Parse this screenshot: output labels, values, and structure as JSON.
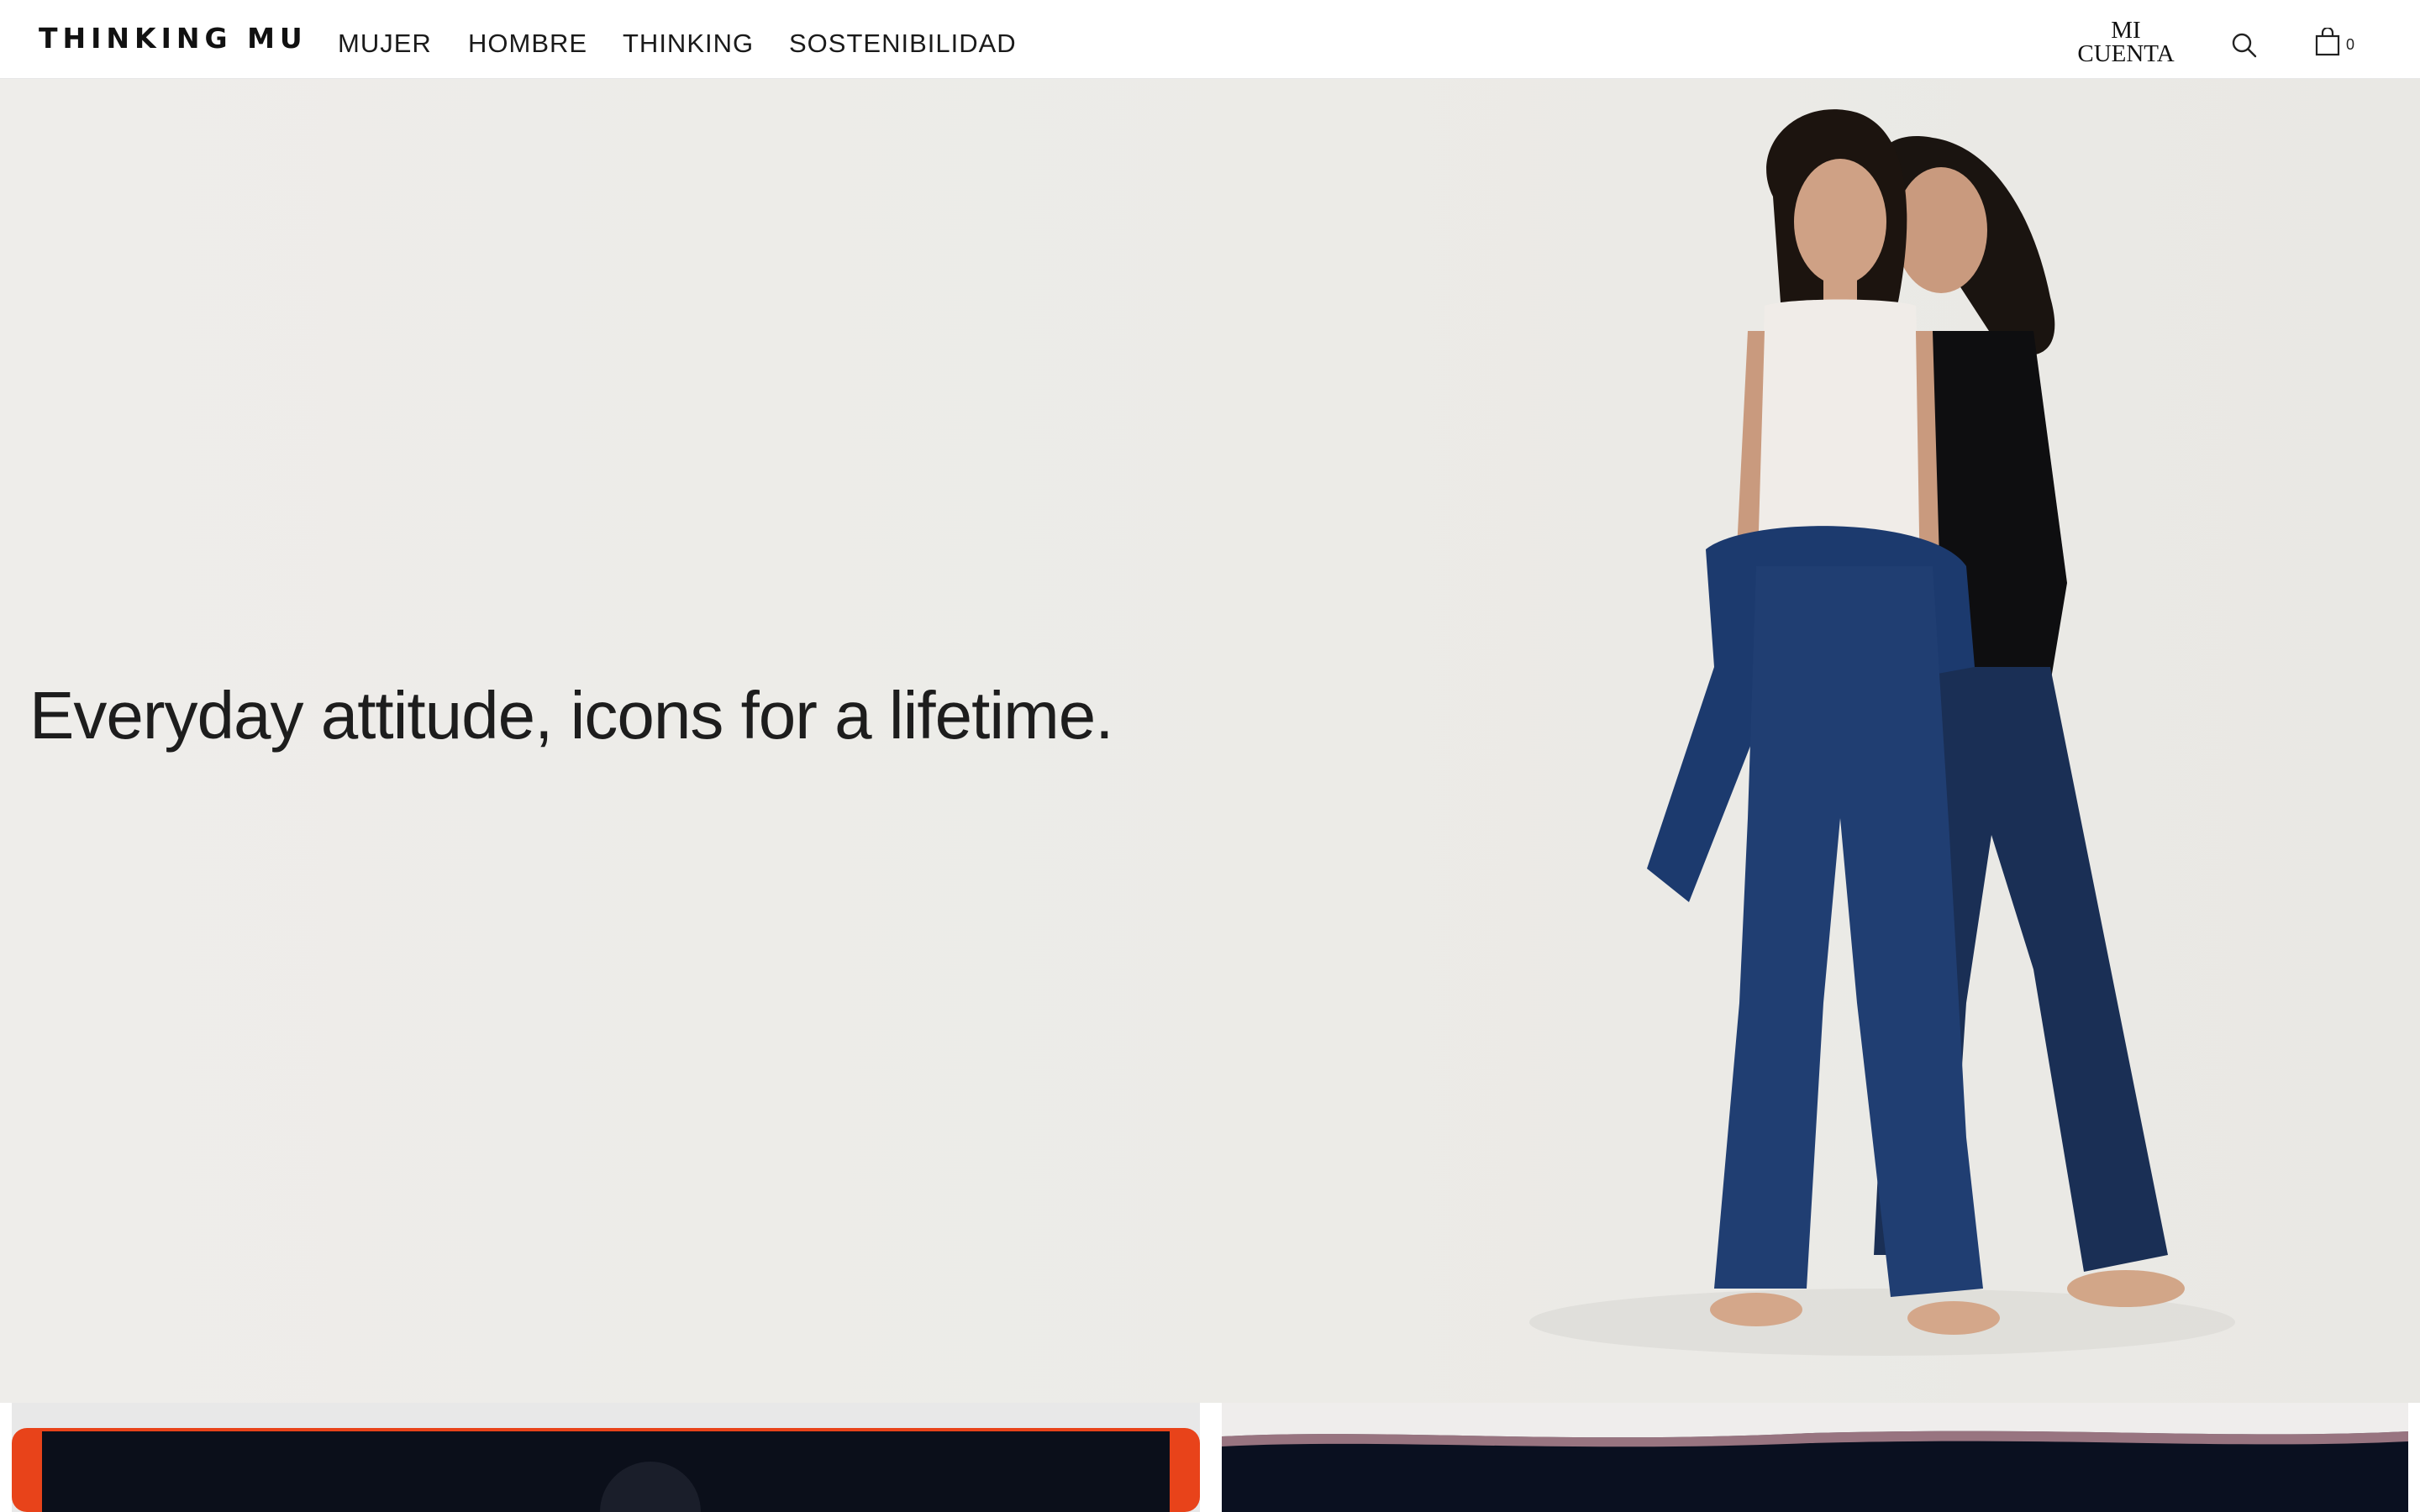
{
  "brand": {
    "logo_text": "THINKING MU"
  },
  "nav": {
    "items": [
      {
        "label": "MUJER"
      },
      {
        "label": "HOMBRE"
      },
      {
        "label": "THINKING"
      },
      {
        "label": "SOSTENIBILIDAD"
      }
    ]
  },
  "header_actions": {
    "account_line1": "MI",
    "account_line2": "CUENTA",
    "search_icon": "search-icon",
    "cart_icon": "shopping-bag-icon",
    "cart_count": "0"
  },
  "hero": {
    "headline": "Everyday attitude, icons for a lifetime."
  },
  "colors": {
    "background": "#ffffff",
    "hero_background": "#eceae6",
    "text": "#1d1d1d",
    "denim": "#1f3b6b",
    "card_left_accent": "#e8431a",
    "card_dark": "#0b0f1a"
  }
}
